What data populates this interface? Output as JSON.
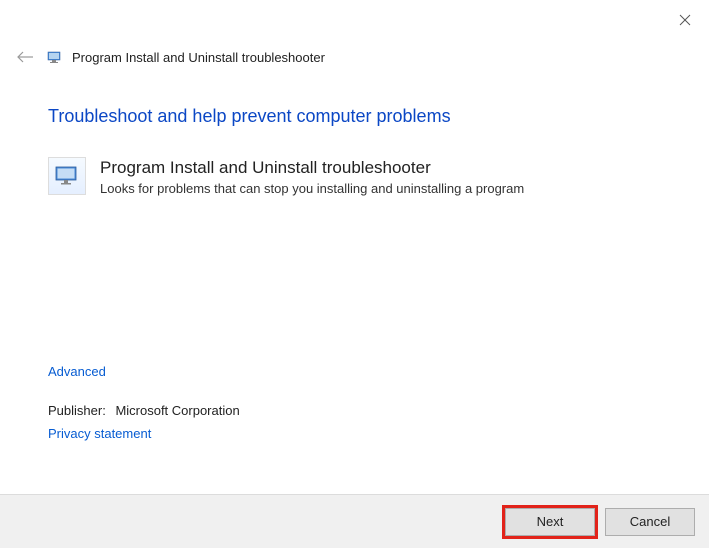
{
  "window": {
    "title": "Program Install and Uninstall troubleshooter"
  },
  "heading": "Troubleshoot and help prevent computer problems",
  "troubleshooter": {
    "title": "Program Install and Uninstall troubleshooter",
    "description": "Looks for problems that can stop you installing and uninstalling a program"
  },
  "links": {
    "advanced": "Advanced",
    "privacy": "Privacy statement"
  },
  "publisher": {
    "label": "Publisher:",
    "name": "Microsoft Corporation"
  },
  "buttons": {
    "next": "Next",
    "cancel": "Cancel"
  }
}
